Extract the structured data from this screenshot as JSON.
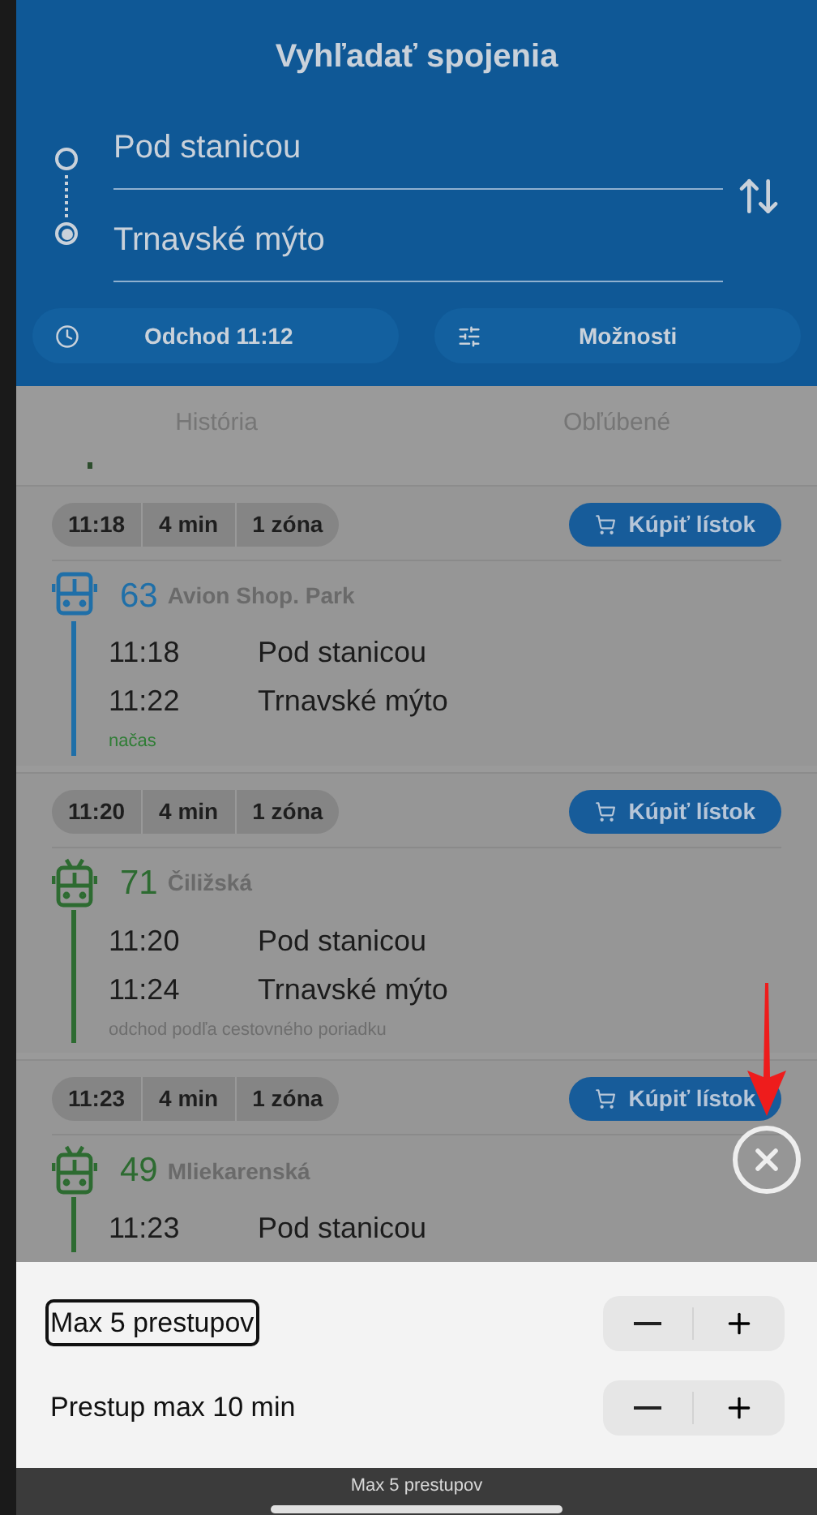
{
  "header": {
    "title": "Vyhľadať spojenia",
    "from": "Pod stanicou",
    "to": "Trnavské mýto",
    "departure_button": "Odchod 11:12",
    "options_button": "Možnosti"
  },
  "tabs": [
    {
      "label": "História",
      "selected": false
    },
    {
      "label": "Obľúbené",
      "selected": false
    }
  ],
  "connections": [
    {
      "time": "11:18",
      "duration": "4 min",
      "zones": "1 zóna",
      "buy_label": "Kúpiť lístok",
      "kind": "bus",
      "color": "#1f6fa8",
      "line": "63",
      "destination": "Avion Shop. Park",
      "stops": [
        {
          "time": "11:18",
          "name": "Pod stanicou"
        },
        {
          "time": "11:22",
          "name": "Trnavské mýto"
        }
      ],
      "note": {
        "kind": "ontime",
        "text": "načas"
      }
    },
    {
      "time": "11:20",
      "duration": "4 min",
      "zones": "1 zóna",
      "buy_label": "Kúpiť lístok",
      "kind": "trolleybus",
      "color": "#2d6b31",
      "line": "71",
      "destination": "Čiližská",
      "stops": [
        {
          "time": "11:20",
          "name": "Pod stanicou"
        },
        {
          "time": "11:24",
          "name": "Trnavské mýto"
        }
      ],
      "note": {
        "kind": "schedule",
        "text": "odchod podľa cestovného poriadku"
      }
    },
    {
      "time": "11:23",
      "duration": "4 min",
      "zones": "1 zóna",
      "buy_label": "Kúpiť lístok",
      "kind": "trolleybus",
      "color": "#2d6b31",
      "line": "49",
      "destination": "Mliekarenská",
      "stops": [
        {
          "time": "11:23",
          "name": "Pod stanicou"
        }
      ]
    }
  ],
  "sheet": {
    "options": [
      {
        "label": "Max 5 prestupov",
        "focused": true
      },
      {
        "label": "Prestup max 10 min",
        "focused": false
      }
    ]
  },
  "caption": "Max 5 prestupov"
}
